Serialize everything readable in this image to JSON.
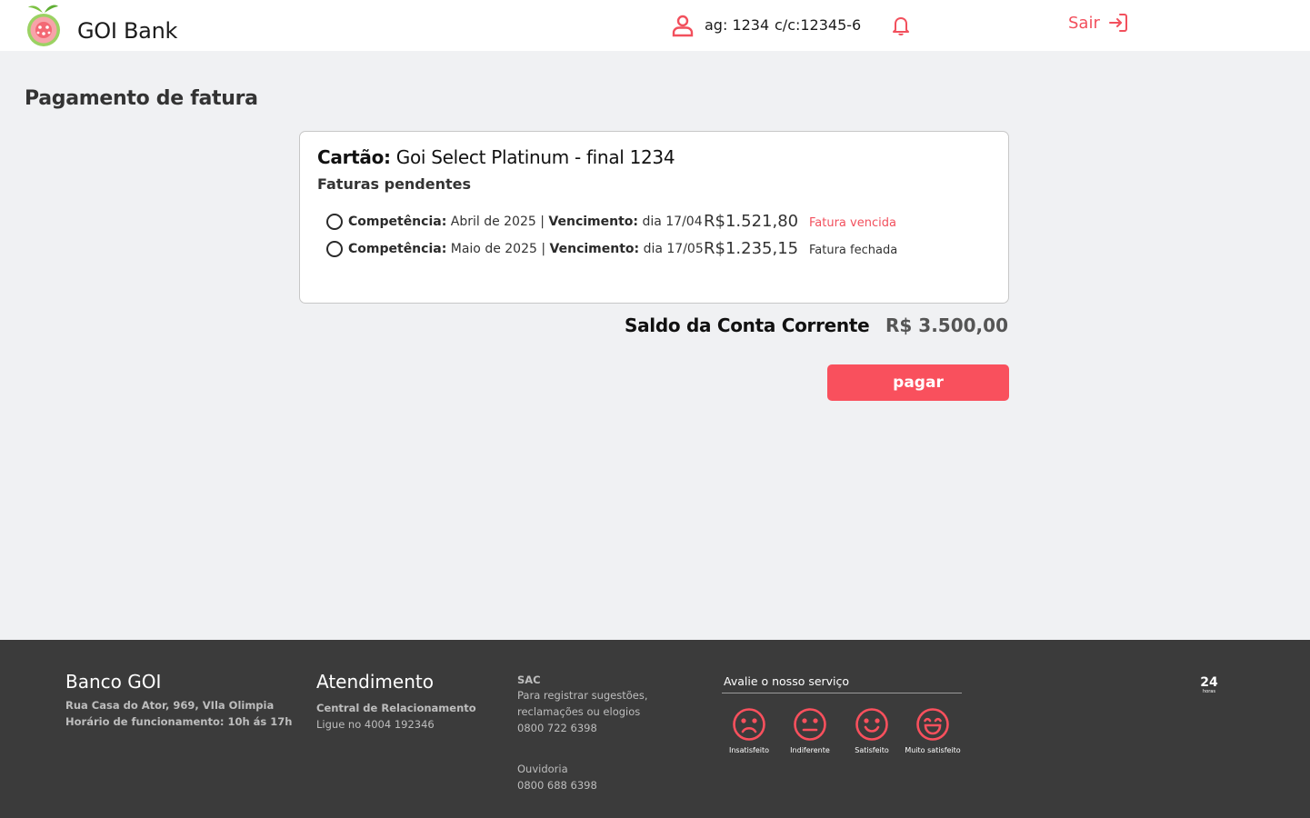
{
  "header": {
    "brand": "GOI Bank",
    "agency": "ag: 1234",
    "account": "c/c:12345-6",
    "logout_label": "Sair"
  },
  "colors": {
    "accent": "#f9505d",
    "status_overdue": "#f2505d",
    "footer_bg": "#3b3b3b",
    "page_bg": "#f0f1f3"
  },
  "icons": {
    "user": "user-icon",
    "bell": "bell-icon",
    "logout": "logout-arrow-icon",
    "logo": "guava-logo"
  },
  "page": {
    "title": "Pagamento de fatura"
  },
  "card": {
    "card_label": "Cartão:",
    "card_name": "Goi Select Platinum - final 1234",
    "subtitle": "Faturas pendentes",
    "invoices": [
      {
        "competence_label": "Competência:",
        "competence": "Abril de 2025",
        "separator": "|",
        "due_label": "Vencimento:",
        "due": "dia 17/04",
        "amount": "R$1.521,80",
        "status": "Fatura vencida",
        "status_color": "#f2505d",
        "selected": false
      },
      {
        "competence_label": "Competência:",
        "competence": "Maio de 2025",
        "separator": "|",
        "due_label": "Vencimento:",
        "due": "dia 17/05",
        "amount": "R$1.235,15",
        "status": "Fatura fechada",
        "status_color": "#333333",
        "selected": false
      }
    ]
  },
  "balance": {
    "label": "Saldo da Conta Corrente",
    "value": "R$ 3.500,00"
  },
  "pay_button": "pagar",
  "footer": {
    "bank": {
      "title": "Banco GOI",
      "address": "Rua Casa do Ator, 969, VIla Olimpia",
      "hours": "Horário de funcionamento: 10h ás 17h"
    },
    "service": {
      "title": "Atendimento",
      "central": "Central de Relacionamento",
      "phone": "Ligue no 4004 192346"
    },
    "sac": {
      "title": "SAC",
      "line1": "Para registrar sugestões,",
      "line2": "reclamações ou elogios",
      "phone": "0800 722 6398",
      "ombudsman": "Ouvidoria",
      "ombudsman_phone": "0800 688 6398"
    },
    "rating": {
      "title": "Avalie o nosso serviço",
      "options": [
        "Insatisfeito",
        "Indiferente",
        "Satisfeito",
        "Muito satisfeito"
      ]
    },
    "badge": {
      "number": "24",
      "text": "horas"
    }
  }
}
